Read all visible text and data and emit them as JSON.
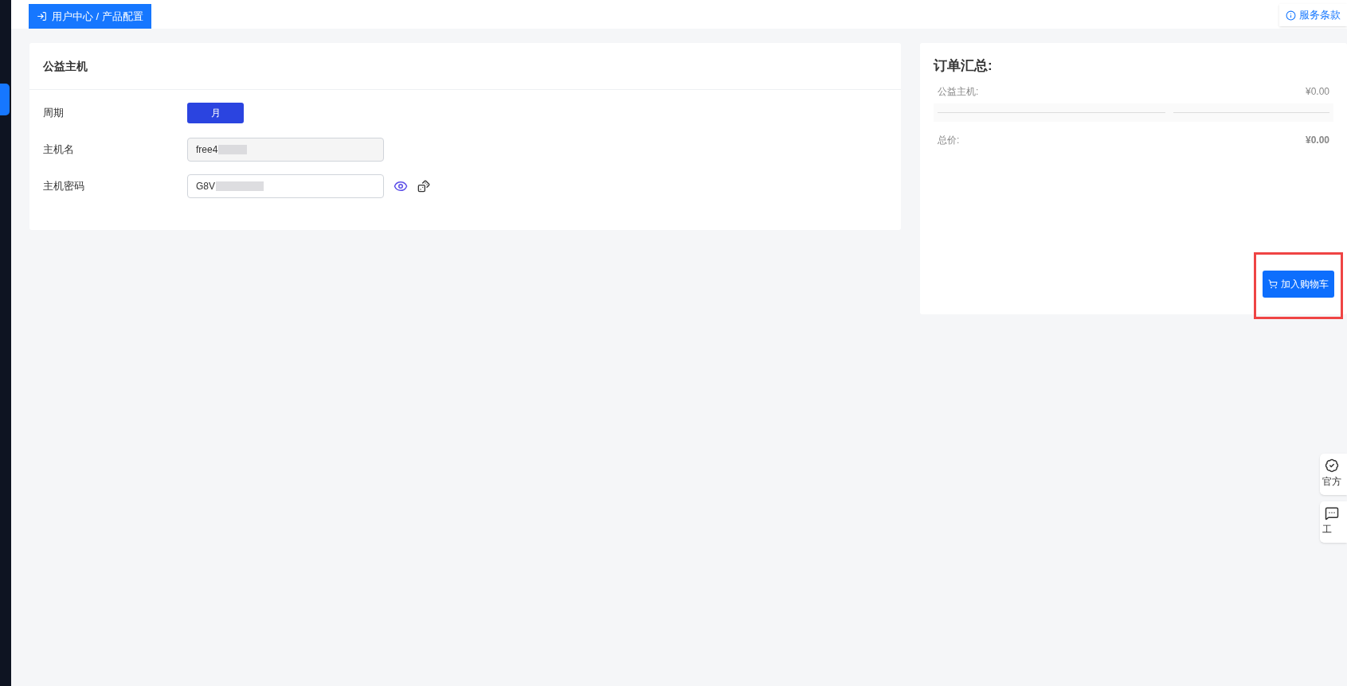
{
  "breadcrumb": {
    "label": "用户中心 / 产品配置"
  },
  "terms_link": {
    "label": "服务条款"
  },
  "config": {
    "title": "公益主机",
    "rows": [
      {
        "kind": "options",
        "label": "周期",
        "options": [
          {
            "label": "月",
            "selected": true
          }
        ]
      },
      {
        "kind": "readonly",
        "label": "主机名",
        "value": "free4"
      },
      {
        "kind": "password",
        "label": "主机密码",
        "value": "G8V"
      }
    ]
  },
  "summary": {
    "title": "订单汇总:",
    "items": [
      {
        "label": "公益主机:",
        "price": "¥0.00"
      }
    ],
    "total_label": "总价:",
    "total": "¥0.00",
    "button": "加入购物车"
  },
  "float_widgets": [
    {
      "kind": "badge",
      "label": "官方"
    },
    {
      "kind": "chat",
      "label": "工"
    }
  ]
}
